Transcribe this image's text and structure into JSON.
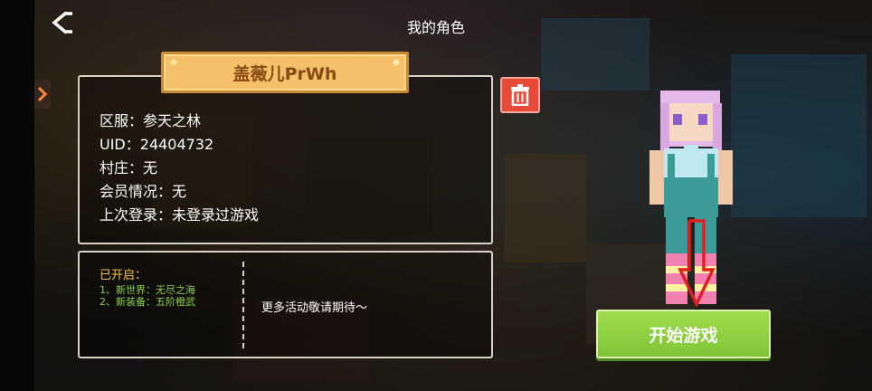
{
  "header": {
    "title": "我的角色"
  },
  "character": {
    "name": "盖薇儿PrWh",
    "details": [
      {
        "label": "区服：",
        "value": "参天之林"
      },
      {
        "label": "UID：",
        "value": "24404732"
      },
      {
        "label": "村庄：",
        "value": "无"
      },
      {
        "label": "会员情况：",
        "value": "无"
      },
      {
        "label": "上次登录：",
        "value": "未登录过游戏"
      }
    ]
  },
  "events": {
    "opened_title": "已开启：",
    "opened_items": [
      "1、新世界：无尽之海",
      "2、新装备：五阶橙武"
    ],
    "more_text": "更多活动敬请期待～"
  },
  "actions": {
    "start_label": "开始游戏"
  },
  "colors": {
    "banner": "#f5c06a",
    "delete": "#e84a3a",
    "start": "#8fd040",
    "opened_title": "#f5c542",
    "opened_item": "#8ed04a",
    "annotation_arrow": "#e02020"
  },
  "icons": {
    "back": "back-chevron-icon",
    "delete": "trash-icon",
    "annotation": "red-down-arrow-icon"
  }
}
